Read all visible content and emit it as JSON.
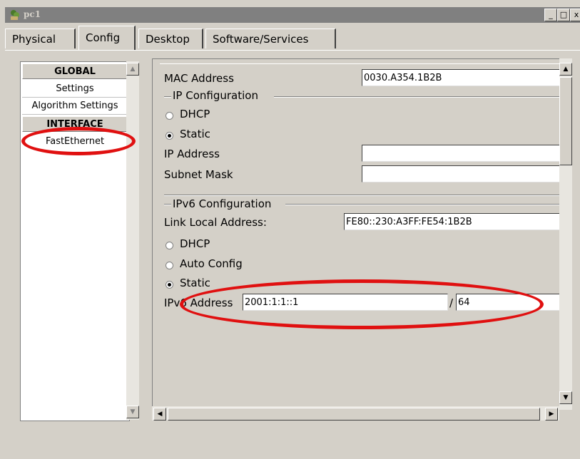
{
  "window": {
    "title": "pc1",
    "buttons": {
      "minimize": "_",
      "maximize": "□",
      "close": "x"
    }
  },
  "tabs": [
    {
      "label": "Physical"
    },
    {
      "label": "Config"
    },
    {
      "label": "Desktop"
    },
    {
      "label": "Software/Services"
    }
  ],
  "sidebar": {
    "global_header": "GLOBAL",
    "global_items": [
      {
        "label": "Settings"
      },
      {
        "label": "Algorithm Settings"
      }
    ],
    "interface_header": "INTERFACE",
    "interface_items": [
      {
        "label": "FastEthernet"
      }
    ]
  },
  "config": {
    "mac_label": "MAC Address",
    "mac_value": "0030.A354.1B2B",
    "ip_group_label": "IP Configuration",
    "dhcp_label": "DHCP",
    "static_label": "Static",
    "ip_address_label": "IP Address",
    "ip_address_value": "",
    "subnet_label": "Subnet Mask",
    "subnet_value": "",
    "ipv6_group_label": "IPv6 Configuration",
    "link_local_label": "Link Local Address:",
    "link_local_value": "FE80::230:A3FF:FE54:1B2B",
    "v6_dhcp_label": "DHCP",
    "v6_auto_label": "Auto Config",
    "v6_static_label": "Static",
    "ipv6_address_label": "IPv6 Address",
    "ipv6_address_value": "2001:1:1::1",
    "prefix_separator": "/",
    "prefix_value": "64"
  },
  "colors": {
    "annotation": "#e01010",
    "window_bg": "#d4d0c8",
    "titlebar": "#808080"
  }
}
